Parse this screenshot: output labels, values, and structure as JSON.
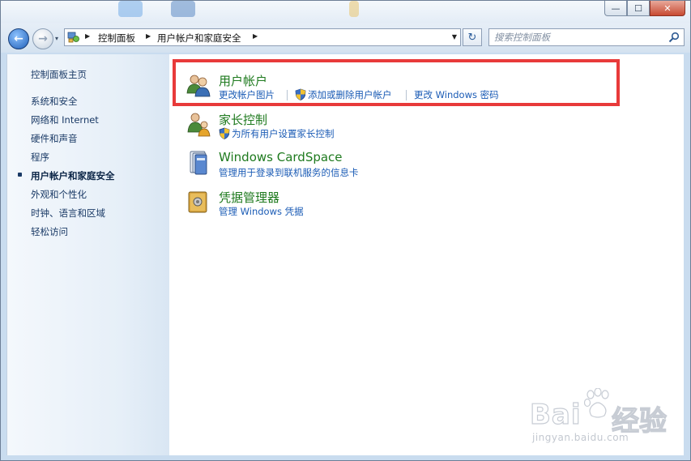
{
  "window": {
    "minimize_label": "—",
    "maximize_label": "☐",
    "close_label": "✕"
  },
  "nav": {
    "back_label": "←",
    "forward_label": "→",
    "dropdown_label": "▾",
    "refresh_label": "↻"
  },
  "breadcrumb": {
    "items": [
      "控制面板",
      "用户帐户和家庭安全"
    ]
  },
  "search": {
    "placeholder": "搜索控制面板"
  },
  "sidebar": {
    "home_label": "控制面板主页",
    "items": [
      {
        "label": "系统和安全"
      },
      {
        "label": "网络和 Internet"
      },
      {
        "label": "硬件和声音"
      },
      {
        "label": "程序"
      },
      {
        "label": "用户帐户和家庭安全",
        "active": true
      },
      {
        "label": "外观和个性化"
      },
      {
        "label": "时钟、语言和区域"
      },
      {
        "label": "轻松访问"
      }
    ]
  },
  "categories": [
    {
      "title": "用户帐户",
      "icon": "user-accounts-icon",
      "links": [
        {
          "label": "更改帐户图片"
        },
        {
          "label": "添加或删除用户帐户",
          "shield": true
        },
        {
          "label": "更改 Windows 密码"
        }
      ]
    },
    {
      "title": "家长控制",
      "icon": "parental-controls-icon",
      "links": [
        {
          "label": "为所有用户设置家长控制",
          "shield": true
        }
      ]
    },
    {
      "title": "Windows CardSpace",
      "icon": "cardspace-icon",
      "links": [
        {
          "label": "管理用于登录到联机服务的信息卡"
        }
      ]
    },
    {
      "title": "凭据管理器",
      "icon": "credential-manager-icon",
      "links": [
        {
          "label": "管理 Windows 凭据"
        }
      ]
    }
  ],
  "watermark": {
    "brand_left": "Bai",
    "brand_right": "经验",
    "url": "jingyan.baidu.com"
  },
  "colors": {
    "highlight": "#e83a3a",
    "link": "#1a5bb5",
    "category_title": "#1e7a1e"
  }
}
